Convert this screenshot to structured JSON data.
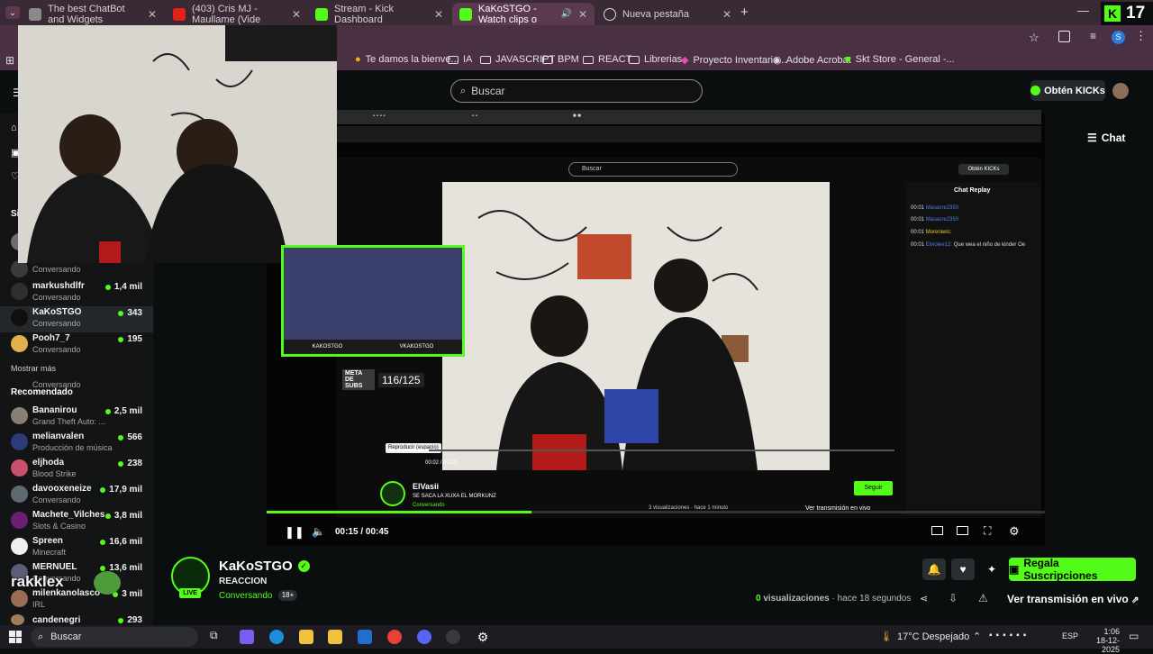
{
  "browser": {
    "tabs": [
      {
        "label": "The best ChatBot and Widgets"
      },
      {
        "label": "(403) Cris MJ - Maullame (Vide"
      },
      {
        "label": "Stream - Kick Dashboard"
      },
      {
        "label": "KaKoSTGO - Watch clips o"
      },
      {
        "label": "Nueva pestaña"
      }
    ],
    "bookmarks": [
      "Te damos la bienve...",
      "IA",
      "JAVASCRIPT",
      "BPM",
      "REACT",
      "Librerias",
      "Proyecto Inventario...",
      "Adobe Acrobat",
      "Skt Store - General -..."
    ],
    "kick_badge_number": "17"
  },
  "header": {
    "search_placeholder": "Buscar",
    "get_kicks": "Obtén KICKs",
    "chat_button": "Chat"
  },
  "sidebar": {
    "section_label": "Si",
    "following": [
      {
        "name": "",
        "category": "Conversando",
        "viewers": ""
      },
      {
        "name": "markushdlfr",
        "category": "Conversando",
        "viewers": "1,4 mil"
      },
      {
        "name": "KaKoSTGO",
        "category": "Conversando",
        "viewers": "343"
      },
      {
        "name": "Pooh7_7",
        "category": "Conversando",
        "viewers": "195"
      }
    ],
    "show_more": "Mostrar más",
    "recommended_title": "Recomendado",
    "recommended": [
      {
        "name": "Bananirou",
        "category": "Grand Theft Auto: ...",
        "viewers": "2,5 mil"
      },
      {
        "name": "melianvalen",
        "category": "Producción de música",
        "viewers": "566"
      },
      {
        "name": "eljhoda",
        "category": "Blood Strike",
        "viewers": "238"
      },
      {
        "name": "davooxeneize",
        "category": "Conversando",
        "viewers": "17,9 mil"
      },
      {
        "name": "Machete_Vilches",
        "category": "Slots & Casino",
        "viewers": "3,8 mil"
      },
      {
        "name": "Spreen",
        "category": "Minecraft",
        "viewers": "16,6 mil"
      },
      {
        "name": "MERNUEL",
        "category": "Conversando",
        "viewers": "13,6 mil"
      },
      {
        "name": "milenkanolasco",
        "category": "IRL",
        "viewers": "3 mil"
      },
      {
        "name": "candenegri",
        "category": "",
        "viewers": "293"
      }
    ],
    "overlay_text": "rakklex"
  },
  "inner_stream": {
    "search": "Buscar",
    "get_kicks": "Obtén KICKs",
    "chat_replay": "Chat Replay",
    "chat_lines": [
      {
        "time": "00:01",
        "user": "Masacre2350",
        "msg": ""
      },
      {
        "time": "00:01",
        "user": "Masacre2350",
        "msg": ""
      },
      {
        "time": "00:01",
        "user": "Moreniwis:",
        "msg": ""
      },
      {
        "time": "00:01",
        "user": "Elviolee12:",
        "msg": "Que wea el niño de kinder Oe"
      }
    ],
    "tooltip": "Reproducir (espacio)",
    "time": "00:02 / 00:19",
    "channel": "ElVasii",
    "title": "SE SACA LA XUXA EL MORKUNZ",
    "category": "Conversando",
    "views": "3 visualizaciones",
    "ago": "hace 1 minuto",
    "follow": "Seguir",
    "live_link": "Ver transmisión en vivo",
    "subs_goal_label": "META DE SUBS",
    "subs_goal": "116/125",
    "cam_names": [
      "KAKOSTGO",
      "VKAKOSTGO"
    ]
  },
  "player": {
    "time": "00:15 / 00:45"
  },
  "channel": {
    "name": "KaKoSTGO",
    "title": "REACCION",
    "category": "Conversando",
    "age": "18+",
    "live": "LIVE",
    "views_count": "0",
    "views_label": "visualizaciones",
    "ago": "hace 18 segundos",
    "subscribe": "Regala Suscripciones",
    "live_link": "Ver transmisión en vivo"
  },
  "taskbar": {
    "search": "Buscar",
    "weather": "17°C Despejado",
    "lang": "ESP",
    "time": "1:06",
    "date": "18-12-2025"
  },
  "colors": {
    "accent": "#53fc18",
    "bg": "#0b0e0f",
    "tabbar": "#3a2a35"
  }
}
